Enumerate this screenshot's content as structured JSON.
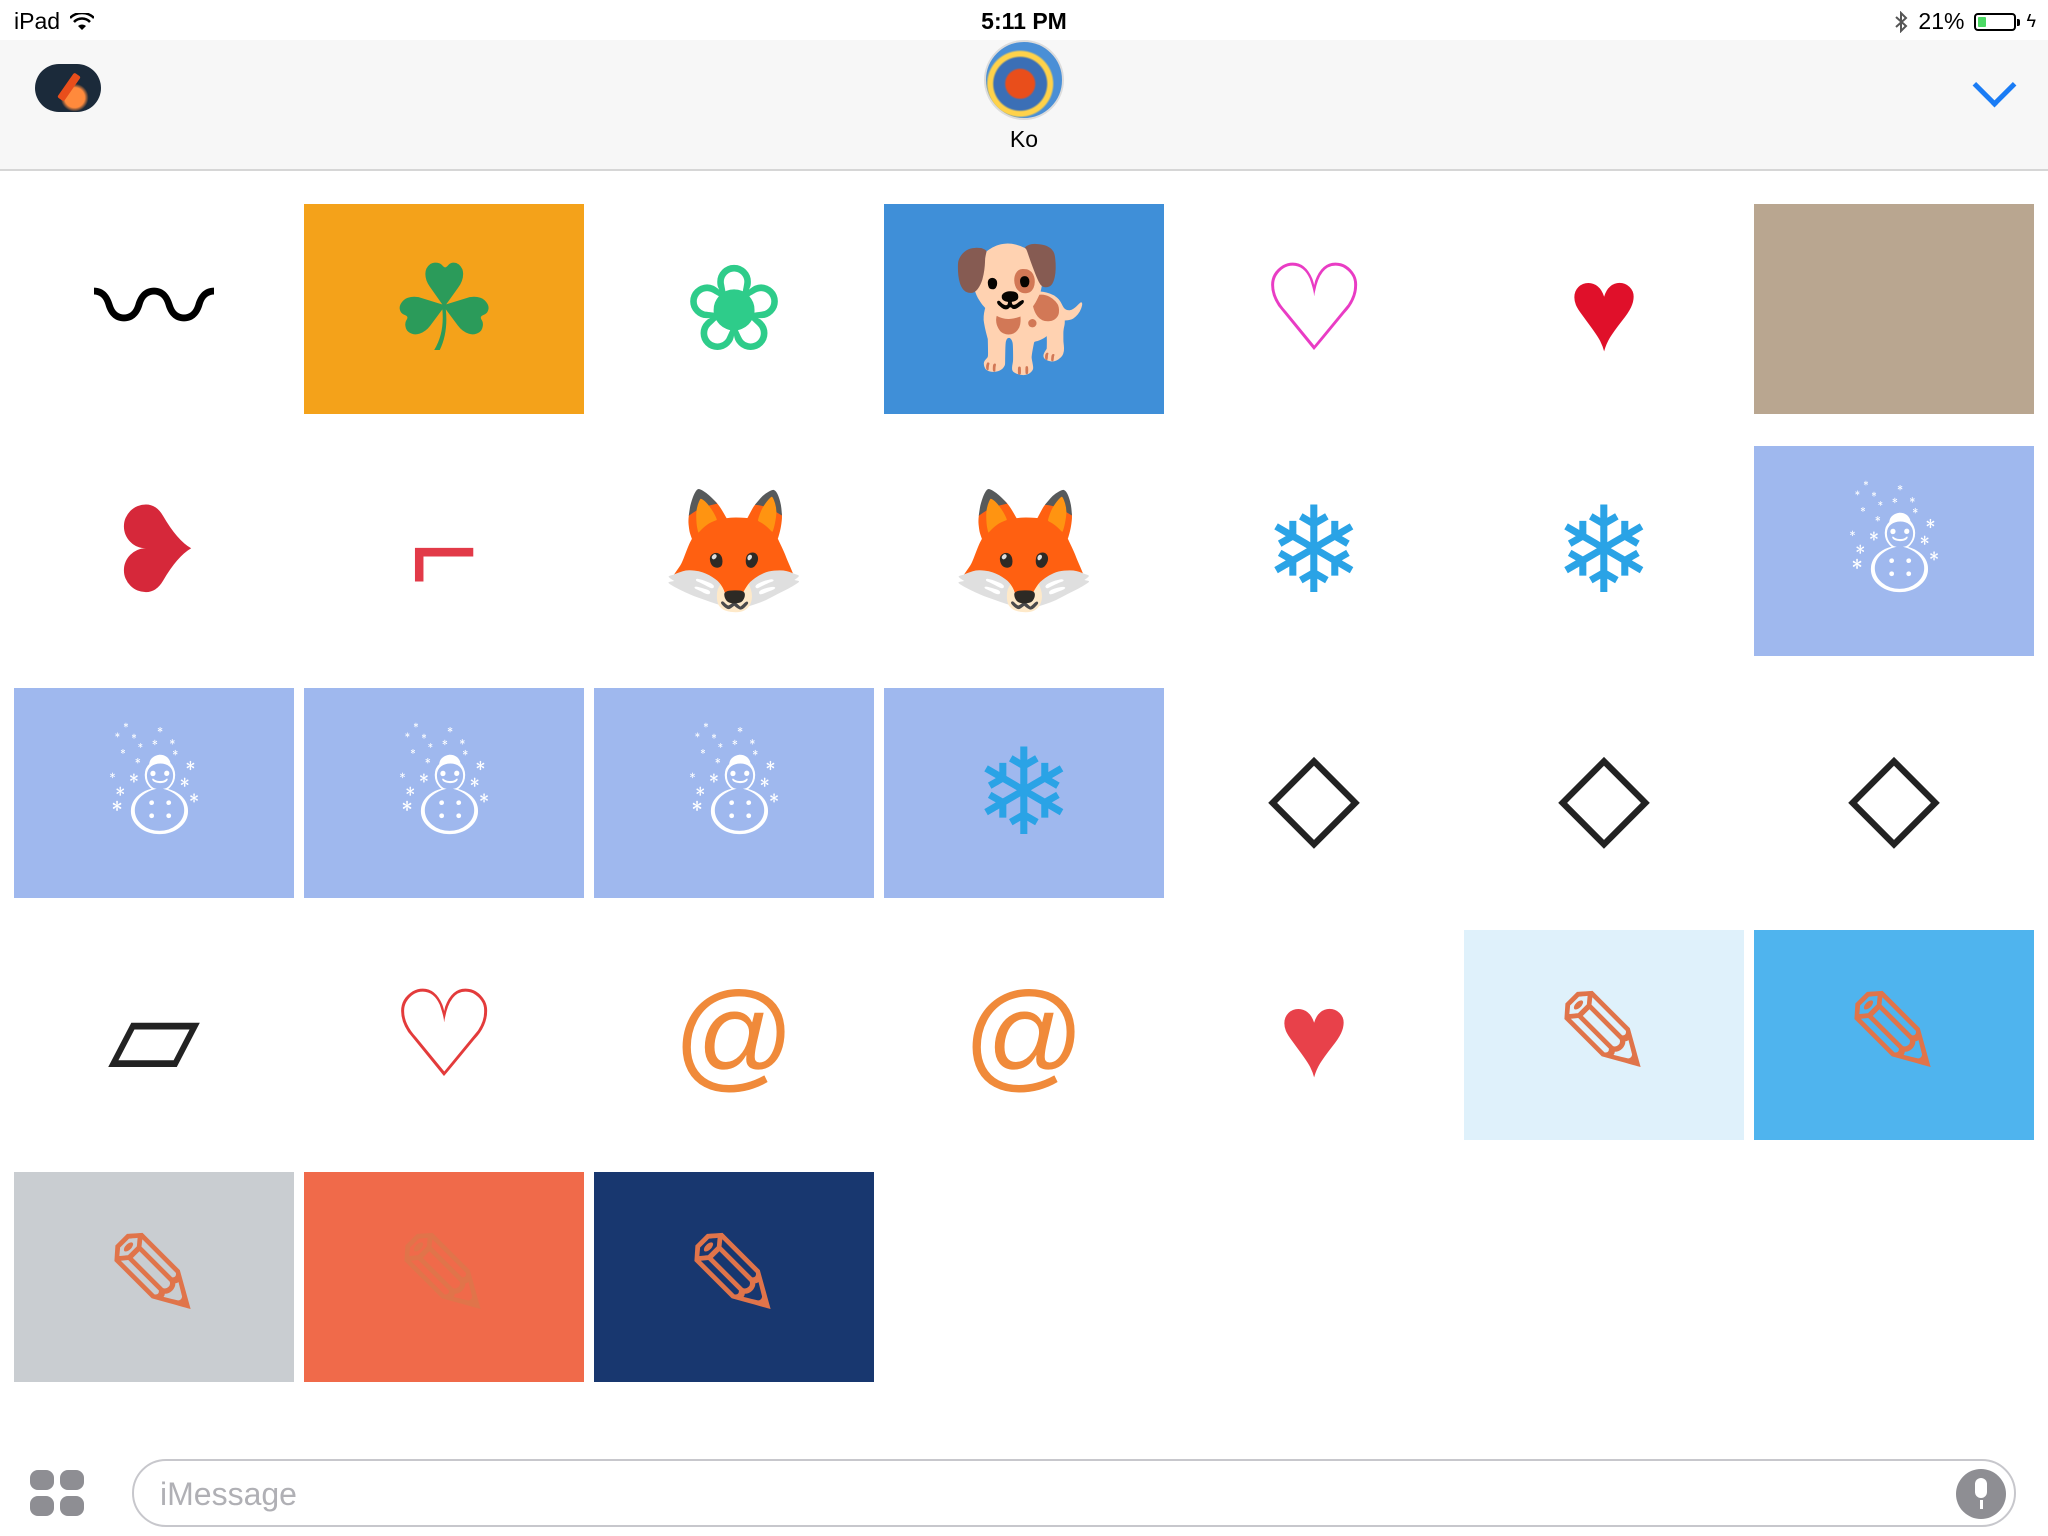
{
  "status_bar": {
    "device": "iPad",
    "time": "5:11 PM",
    "battery": "21%",
    "battery_level": 0.21
  },
  "header": {
    "contact_name": "Ko"
  },
  "stickers": [
    {
      "name": "sticker-ink-boat",
      "bg": "#ffffff",
      "glyph": "〰",
      "color": "#000000"
    },
    {
      "name": "sticker-clover-sunset",
      "bg": "#f4a21a",
      "glyph": "☘",
      "color": "#2b9b5a"
    },
    {
      "name": "sticker-clover-outline",
      "bg": "#ffffff",
      "glyph": "❀",
      "color": "#2ecc8a"
    },
    {
      "name": "sticker-dog-hearts",
      "bg": "#3f8fd8",
      "glyph": "🐕",
      "color": "#e8842a"
    },
    {
      "name": "sticker-love-pink",
      "bg": "#ffffff",
      "glyph": "♡",
      "color": "#e93cc4"
    },
    {
      "name": "sticker-red-hearts",
      "bg": "#ffffff",
      "glyph": "♥",
      "color": "#e0102a"
    },
    {
      "name": "sticker-brown-paper",
      "bg": "#b9a690",
      "glyph": "",
      "color": "#b9a690"
    },
    {
      "name": "sticker-love-hearts-red",
      "bg": "#ffffff",
      "glyph": "❥",
      "color": "#d6283a"
    },
    {
      "name": "sticker-candy-cane",
      "bg": "#ffffff",
      "glyph": "⌐",
      "color": "#e23a48"
    },
    {
      "name": "sticker-fox-large",
      "bg": "#ffffff",
      "glyph": "🦊",
      "color": "#e3661c"
    },
    {
      "name": "sticker-fox-small",
      "bg": "#ffffff",
      "glyph": "🦊",
      "color": "#e3661c"
    },
    {
      "name": "sticker-single-snowflake",
      "bg": "#ffffff",
      "glyph": "❄",
      "color": "#2aa3e6"
    },
    {
      "name": "sticker-snowflakes",
      "bg": "#ffffff",
      "glyph": "❄",
      "color": "#2aa3e6"
    },
    {
      "name": "sticker-snowman-1",
      "bg": "#9fb8ee",
      "glyph": "☃",
      "color": "#ffffff"
    },
    {
      "name": "sticker-snowman-2",
      "bg": "#9fb8ee",
      "glyph": "☃",
      "color": "#ffffff"
    },
    {
      "name": "sticker-snowman-3",
      "bg": "#9fb8ee",
      "glyph": "☃",
      "color": "#ffffff"
    },
    {
      "name": "sticker-snowman-4",
      "bg": "#9fb8ee",
      "glyph": "☃",
      "color": "#ffffff"
    },
    {
      "name": "sticker-snowman-5",
      "bg": "#9fb8ee",
      "glyph": "❄",
      "color": "#2aa3e6"
    },
    {
      "name": "sticker-sketch-cube-1",
      "bg": "#ffffff",
      "glyph": "◇",
      "color": "#222222"
    },
    {
      "name": "sticker-sketch-cube-2",
      "bg": "#ffffff",
      "glyph": "◇",
      "color": "#222222"
    },
    {
      "name": "sticker-sketch-cube-3",
      "bg": "#ffffff",
      "glyph": "◇",
      "color": "#222222"
    },
    {
      "name": "sticker-sketch-cube-4",
      "bg": "#ffffff",
      "glyph": "▱",
      "color": "#222222"
    },
    {
      "name": "sticker-red-scribble-hearts",
      "bg": "#ffffff",
      "glyph": "♡",
      "color": "#e33b3b"
    },
    {
      "name": "sticker-fireball-swirls",
      "bg": "#ffffff",
      "glyph": "@",
      "color": "#f08a3a"
    },
    {
      "name": "sticker-orange-swirls",
      "bg": "#ffffff",
      "glyph": "@",
      "color": "#f08a3a"
    },
    {
      "name": "sticker-big-outline-hearts",
      "bg": "#ffffff",
      "glyph": "♥",
      "color": "#e8414a"
    },
    {
      "name": "sticker-pencil-waving",
      "bg": "#dff1fb",
      "glyph": "✎",
      "color": "#e0744a"
    },
    {
      "name": "sticker-pencil-beach",
      "bg": "#4fb4ee",
      "glyph": "✎",
      "color": "#e0744a"
    },
    {
      "name": "sticker-pencil-crying",
      "bg": "#c9cdd1",
      "glyph": "✎",
      "color": "#e0744a"
    },
    {
      "name": "sticker-pencil-dancing",
      "bg": "#f06a4a",
      "glyph": "✎",
      "color": "#e0744a"
    },
    {
      "name": "sticker-pencil-computer",
      "bg": "#18376f",
      "glyph": "✎",
      "color": "#e0744a"
    }
  ],
  "composer": {
    "placeholder": "iMessage"
  }
}
